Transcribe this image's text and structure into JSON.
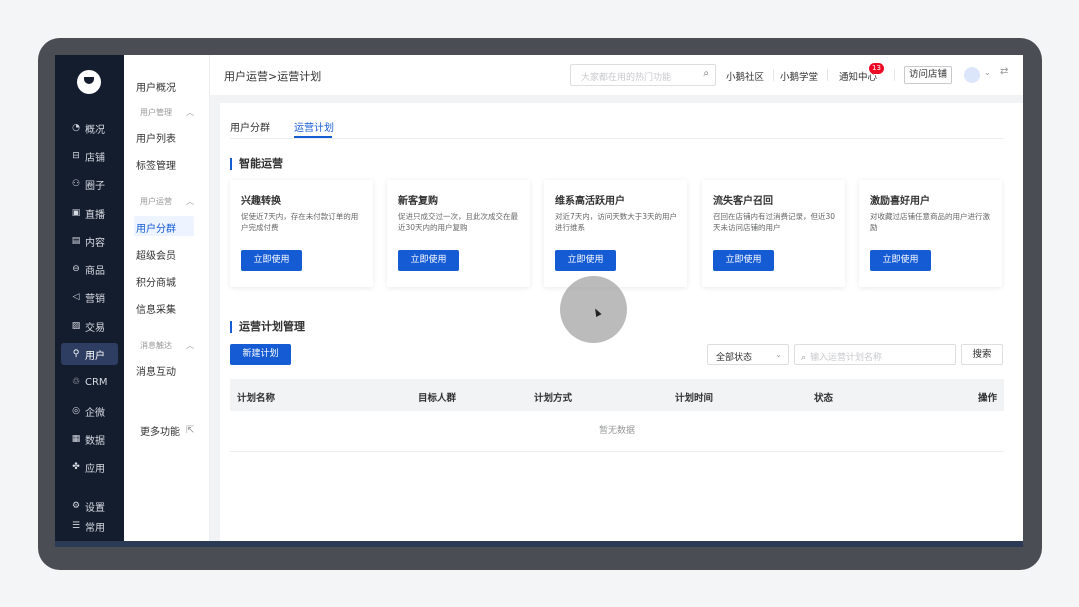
{
  "nav_primary": [
    {
      "icon": "◔",
      "label": "概况"
    },
    {
      "icon": "⊟",
      "label": "店铺"
    },
    {
      "icon": "⚇",
      "label": "圈子"
    },
    {
      "icon": "▣",
      "label": "直播"
    },
    {
      "icon": "▤",
      "label": "内容"
    },
    {
      "icon": "⊖",
      "label": "商品"
    },
    {
      "icon": "◁",
      "label": "营销"
    },
    {
      "icon": "▨",
      "label": "交易"
    },
    {
      "icon": "⚲",
      "label": "用户"
    },
    {
      "icon": "♲",
      "label": "CRM"
    },
    {
      "icon": "◎",
      "label": "企微"
    },
    {
      "icon": "▦",
      "label": "数据"
    },
    {
      "icon": "✤",
      "label": "应用"
    },
    {
      "icon": "⚙",
      "label": "设置"
    },
    {
      "icon": "☰",
      "label": "常用"
    }
  ],
  "nav_secondary": {
    "overview": "用户概况",
    "group_user_mgmt": "用户管理",
    "user_list": "用户列表",
    "tag_mgmt": "标签管理",
    "group_user_ops": "用户运营",
    "user_segment": "用户分群",
    "super_member": "超级会员",
    "points_mall": "积分商城",
    "info_collect": "信息采集",
    "group_msg": "消息触达",
    "msg_interact": "消息互动",
    "more": "更多功能",
    "collapse_glyph": "︿",
    "more_glyph": "⇱"
  },
  "header": {
    "breadcrumb": "用户运营>运营计划",
    "search_placeholder": "大家都在用的热门功能",
    "search_glyph": "⌕",
    "community": "小鹅社区",
    "academy": "小鹅学堂",
    "notify": "通知中心",
    "notify_count": "13",
    "visit_store": "访问店铺",
    "chevron": "⌄",
    "swap": "⇄"
  },
  "tabs": [
    {
      "label": "用户分群"
    },
    {
      "label": "运营计划"
    }
  ],
  "smart_ops": {
    "title": "智能运营",
    "cards": [
      {
        "title": "兴趣转换",
        "desc": "促使近7天内，存在未付款订单的用户完成付费",
        "btn": "立即使用"
      },
      {
        "title": "新客复购",
        "desc": "促进只成交过一次，且此次成交在最近30天内的用户复购",
        "btn": "立即使用"
      },
      {
        "title": "维系高活跃用户",
        "desc": "对近7天内，访问天数大于3天的用户进行维系",
        "btn": "立即使用"
      },
      {
        "title": "流失客户召回",
        "desc": "召回在店铺内有过消费记录，但近30天未访问店铺的用户",
        "btn": "立即使用"
      },
      {
        "title": "激励喜好用户",
        "desc": "对收藏过店铺任意商品的用户进行激励",
        "btn": "立即使用"
      }
    ]
  },
  "plan_mgmt": {
    "title": "运营计划管理",
    "new_btn": "新建计划",
    "status_select": "全部状态",
    "status_glyph": "⌄",
    "search_placeholder": "输入运营计划名称",
    "search_glyph": "⌕",
    "search_btn": "搜索",
    "columns": [
      "计划名称",
      "目标人群",
      "计划方式",
      "计划时间",
      "状态",
      "操作"
    ],
    "empty": "暂无数据"
  }
}
